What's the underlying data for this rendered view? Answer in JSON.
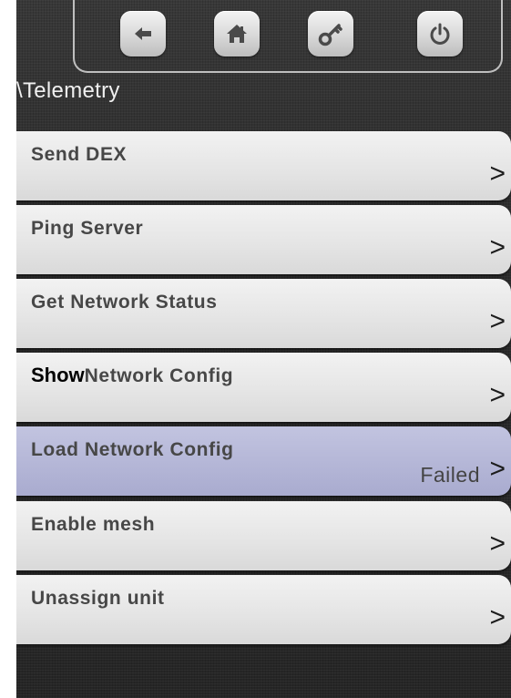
{
  "header": {
    "buttons": [
      {
        "name": "back",
        "icon": "back-arrow-icon"
      },
      {
        "name": "home",
        "icon": "home-icon"
      },
      {
        "name": "key",
        "icon": "key-icon"
      },
      {
        "name": "power",
        "icon": "power-icon"
      }
    ],
    "breadcrumb": "\\Telemetry"
  },
  "menu": {
    "arrow": ">",
    "items": [
      {
        "prefix": "",
        "label": "Send DEX",
        "status": ""
      },
      {
        "prefix": "",
        "label": "Ping Server",
        "status": ""
      },
      {
        "prefix": "",
        "label": "Get Network Status",
        "status": ""
      },
      {
        "prefix": "Show",
        "label": "Network Config",
        "status": ""
      },
      {
        "prefix": "",
        "label": "Load Network Config",
        "status": "Failed",
        "highlighted": true
      },
      {
        "prefix": "",
        "label": "Enable mesh",
        "status": ""
      },
      {
        "prefix": "",
        "label": "Unassign unit",
        "status": ""
      }
    ]
  },
  "colors": {
    "background": "#2a2a2a",
    "item": "#e6e6e6",
    "item_highlight": "#b3b5d6",
    "label": "#474747"
  }
}
